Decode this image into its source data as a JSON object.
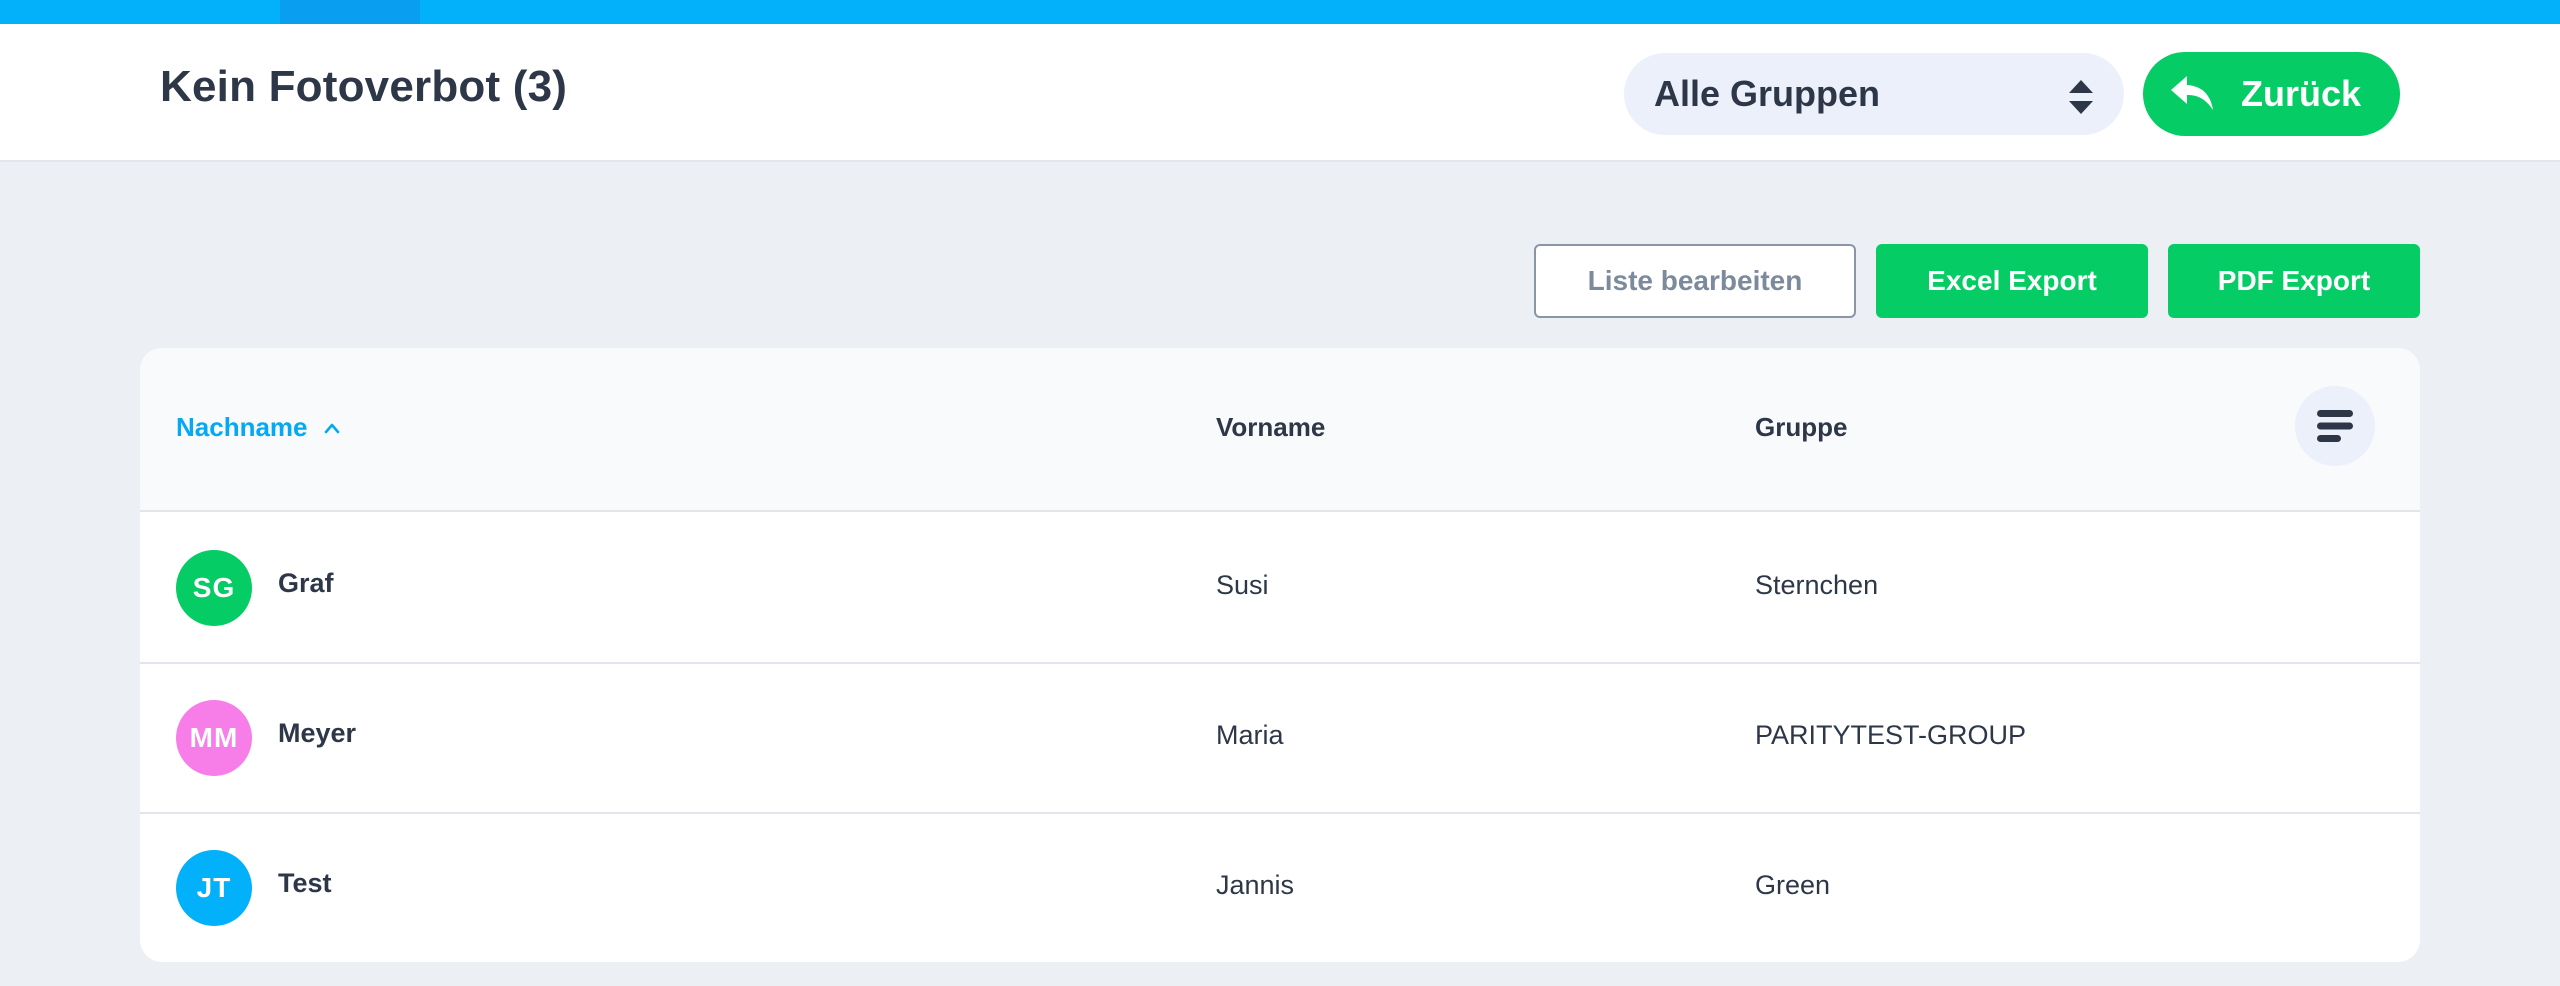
{
  "header": {
    "title": "Kein Fotoverbot (3)",
    "group_select": {
      "selected": "Alle Gruppen",
      "icon": "sort-updown-icon"
    },
    "back_button": {
      "label": "Zurück",
      "icon": "reply-arrow-icon"
    }
  },
  "actions": {
    "edit_list": "Liste bearbeiten",
    "excel_export": "Excel Export",
    "pdf_export": "PDF Export"
  },
  "table": {
    "columns": {
      "lastname": "Nachname",
      "firstname": "Vorname",
      "group": "Gruppe"
    },
    "sort": {
      "column": "lastname",
      "direction": "ascending",
      "icon": "chevron-up-icon"
    },
    "menu_icon": "menu-lines-icon",
    "rows": [
      {
        "initials": "SG",
        "avatar_color": "#05cc64",
        "lastname": "Graf",
        "firstname": "Susi",
        "group": "Sternchen"
      },
      {
        "initials": "MM",
        "avatar_color": "#f77ee9",
        "lastname": "Meyer",
        "firstname": "Maria",
        "group": "PARITYTEST-GROUP"
      },
      {
        "initials": "JT",
        "avatar_color": "#03b0fa",
        "lastname": "Test",
        "firstname": "Jannis",
        "group": "Green"
      }
    ]
  },
  "colors": {
    "accent_blue": "#03b0fa",
    "accent_green": "#05cc64",
    "background": "#eceff4",
    "text": "#2d3748"
  }
}
